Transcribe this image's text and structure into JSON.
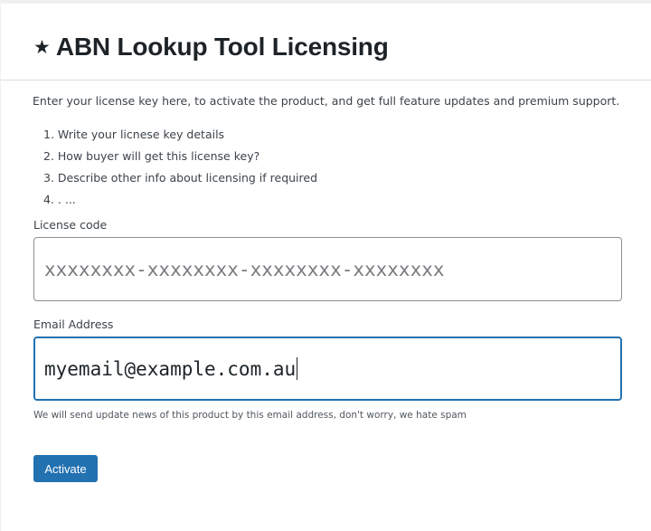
{
  "header": {
    "icon": "star-icon",
    "title": "ABN Lookup Tool Licensing"
  },
  "intro_text": "Enter your license key here, to activate the product, and get full feature updates and premium support.",
  "steps": [
    "1. Write your licnese key details",
    "2. How buyer will get this license key?",
    "3. Describe other info about licensing if required",
    "4. . ..."
  ],
  "license_field": {
    "label": "License code",
    "placeholder": "xxxxxxxx-xxxxxxxx-xxxxxxxx-xxxxxxxx",
    "value": ""
  },
  "email_field": {
    "label": "Email Address",
    "value": "myemail@example.com.au",
    "hint": "We will send update news of this product by this email address, don't worry, we hate spam"
  },
  "activate_button": {
    "label": "Activate"
  },
  "colors": {
    "accent": "#2271b1",
    "title": "#1d2327",
    "text": "#3c434a"
  }
}
